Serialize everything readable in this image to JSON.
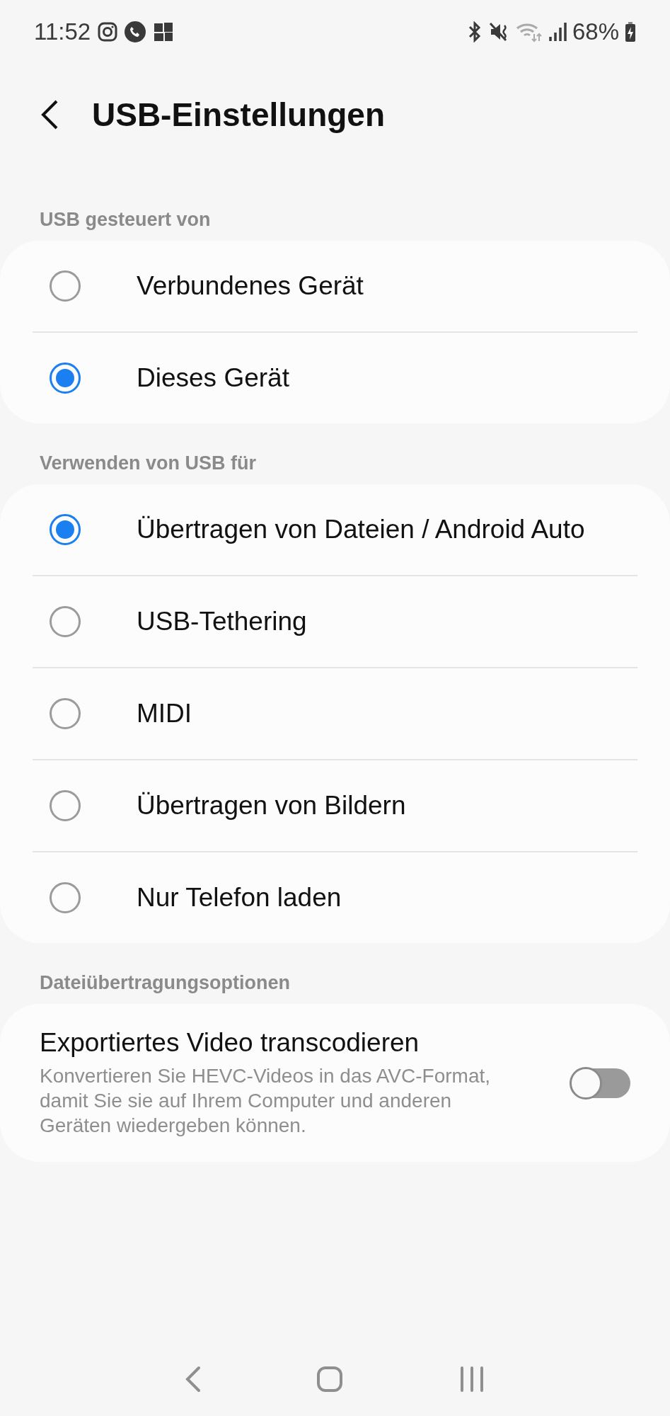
{
  "status_bar": {
    "time": "11:52",
    "battery": "68%"
  },
  "header": {
    "title": "USB-Einstellungen"
  },
  "sections": [
    {
      "title": "USB gesteuert von",
      "kind": "radio",
      "options": [
        {
          "label": "Verbundenes Gerät",
          "selected": false
        },
        {
          "label": "Dieses Gerät",
          "selected": true
        }
      ]
    },
    {
      "title": "Verwenden von USB für",
      "kind": "radio",
      "options": [
        {
          "label": "Übertragen von Dateien / Android Auto",
          "selected": true
        },
        {
          "label": "USB-Tethering",
          "selected": false
        },
        {
          "label": "MIDI",
          "selected": false
        },
        {
          "label": "Übertragen von Bildern",
          "selected": false
        },
        {
          "label": "Nur Telefon laden",
          "selected": false
        }
      ]
    },
    {
      "title": "Dateiübertragungsoptionen",
      "kind": "switch",
      "items": [
        {
          "title": "Exportiertes Video transcodieren",
          "description": "Konvertieren Sie HEVC-Videos in das AVC-Format, damit Sie sie auf Ihrem Computer und anderen Geräten wiedergeben können.",
          "on": false
        }
      ]
    }
  ]
}
